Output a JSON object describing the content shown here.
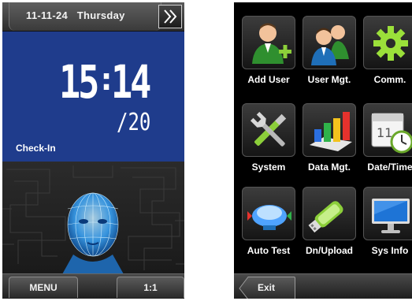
{
  "left_screen": {
    "date": "11-11-24",
    "weekday": "Thursday",
    "next_icon": "double-chevron-right-icon",
    "clock": {
      "hours": "15",
      "separator": ":",
      "minutes": "14",
      "day": "/20"
    },
    "status": "Check-In",
    "face_icon": "face-scan-icon",
    "bottom": {
      "menu_label": "MENU",
      "ratio_label": "1:1"
    },
    "colors": {
      "clock_panel": "#1f3c8c",
      "face_glow": "#3aa8ff"
    }
  },
  "right_screen": {
    "menu_items": [
      {
        "label": "Add User",
        "icon": "add-user-icon"
      },
      {
        "label": "User Mgt.",
        "icon": "user-management-icon"
      },
      {
        "label": "Comm.",
        "icon": "gear-icon"
      },
      {
        "label": "System",
        "icon": "tools-icon"
      },
      {
        "label": "Data Mgt.",
        "icon": "bar-chart-icon"
      },
      {
        "label": "Date/Time",
        "icon": "calendar-clock-icon"
      },
      {
        "label": "Auto Test",
        "icon": "test-icon"
      },
      {
        "label": "Dn/Upload",
        "icon": "usb-drive-icon"
      },
      {
        "label": "Sys Info",
        "icon": "monitor-icon"
      }
    ],
    "exit_label": "Exit"
  }
}
